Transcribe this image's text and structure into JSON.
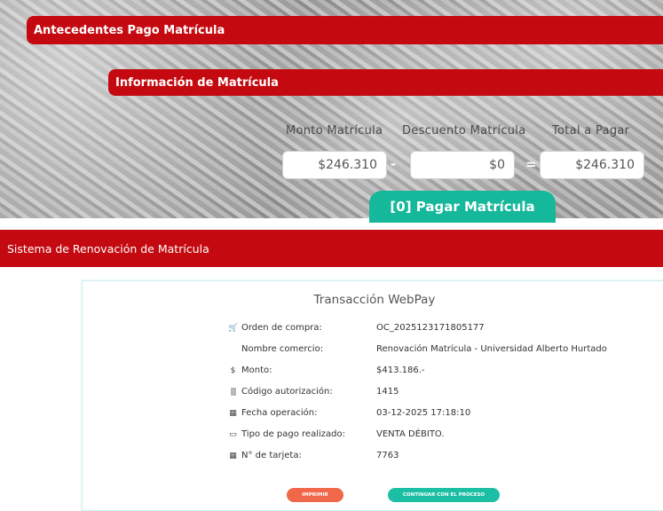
{
  "enrollment": {
    "section_title": "Antecedentes Pago Matrícula",
    "info_title": "Información de Matrícula",
    "columns": {
      "monto_label": "Monto Matrícula",
      "descuento_label": "Descuento Matrícula",
      "total_label": "Total a Pagar"
    },
    "values": {
      "monto": "$246.310",
      "descuento": "$0",
      "total": "$246.310"
    },
    "operators": {
      "minus": "-",
      "equals": "="
    },
    "pay_button": "[0] Pagar Matrícula"
  },
  "renewal_bar": "Sistema de Renovación de Matrícula",
  "transaction": {
    "title": "Transacción WebPay",
    "rows": [
      {
        "icon": "cart-icon",
        "glyph": "🛒",
        "label": "Orden de compra:",
        "value": "OC_2025123171805177"
      },
      {
        "icon": "",
        "glyph": "",
        "label": "Nombre comercio:",
        "value": "Renovación Matrícula - Universidad Alberto Hurtado"
      },
      {
        "icon": "dollar-icon",
        "glyph": "$",
        "label": "Monto:",
        "value": "$413.186.-"
      },
      {
        "icon": "barcode-icon",
        "glyph": "|||",
        "label": "Código autorización:",
        "value": "1415"
      },
      {
        "icon": "calendar-icon",
        "glyph": "▦",
        "label": "Fecha operación:",
        "value": "03-12-2025 17:18:10"
      },
      {
        "icon": "credit-card-icon",
        "glyph": "▭",
        "label": "Tipo de pago realizado:",
        "value": "VENTA DÉBITO."
      },
      {
        "icon": "calendar-icon",
        "glyph": "▦",
        "label": "N° de tarjeta:",
        "value": "7763"
      }
    ],
    "print_button": "IMPRIMIR",
    "continue_button": "CONTINUAR CON EL PROCESO"
  }
}
